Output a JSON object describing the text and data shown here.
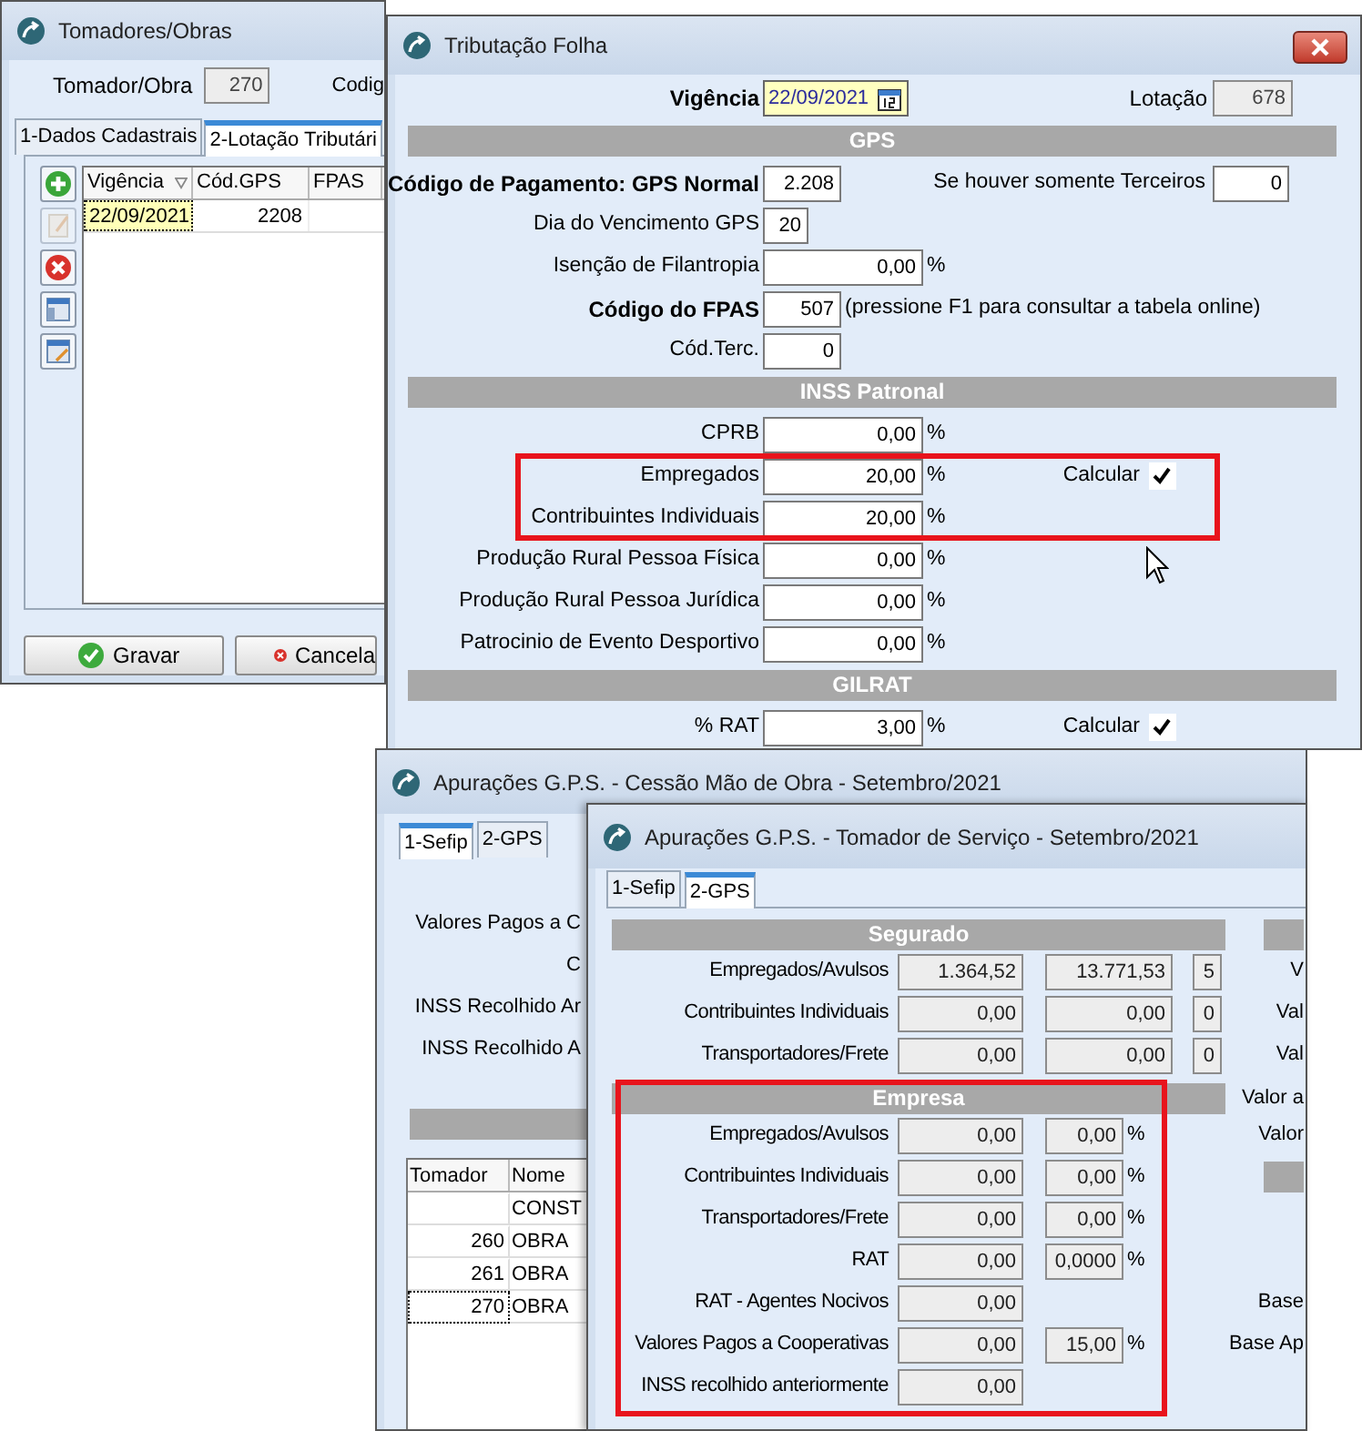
{
  "tomadores_window": {
    "title": "Tomadores/Obras",
    "tomador_label": "Tomador/Obra",
    "tomador_value": "270",
    "codigo_label": "Codig",
    "tabs": [
      {
        "label": "1-Dados Cadastrais",
        "selected": false
      },
      {
        "label": "2-Lotação Tributári",
        "selected": true
      }
    ],
    "toolbar": [
      {
        "kind": "add",
        "disabled": false
      },
      {
        "kind": "edit",
        "disabled": true
      },
      {
        "kind": "delete",
        "disabled": false
      },
      {
        "kind": "grid",
        "disabled": false
      },
      {
        "kind": "grid-edit",
        "disabled": false
      }
    ],
    "table": {
      "columns": [
        "Vigência",
        "Cód.GPS",
        "FPAS"
      ],
      "rows": [
        {
          "vigencia": "22/09/2021",
          "cod_gps": "2208",
          "selected": true
        }
      ]
    },
    "buttons": [
      {
        "kind": "save",
        "label": "Gravar"
      },
      {
        "kind": "cancel",
        "label": "Cancela"
      }
    ]
  },
  "tributacao_window": {
    "title": "Tributação Folha",
    "vigencia_label": "Vigência",
    "vigencia_value": "22/09/2021",
    "lotacao_label": "Lotação",
    "lotacao_value": "678",
    "sections": [
      {
        "title": "GPS",
        "rows": [
          {
            "label": "Código de Pagamento: GPS Normal",
            "bold": true,
            "kind": "medium",
            "value": "2.208",
            "extra": {
              "label": "Se houver somente Terceiros",
              "value": "0"
            }
          },
          {
            "label": "Dia do Vencimento GPS",
            "bold": false,
            "kind": "small",
            "value": "20"
          },
          {
            "label": "Isenção de Filantropia",
            "bold": false,
            "kind": "wide",
            "value": "0,00",
            "suffix": "%"
          },
          {
            "label": "Código do FPAS",
            "bold": true,
            "kind": "medium",
            "value": "507",
            "suffix": "(pressione F1 para consultar a tabela online)"
          },
          {
            "label": "Cód.Terc.",
            "bold": false,
            "kind": "medium",
            "value": "0"
          }
        ]
      },
      {
        "title": "INSS Patronal",
        "rows": [
          {
            "label": "CPRB",
            "bold": false,
            "kind": "wide",
            "value": "0,00",
            "suffix": "%"
          },
          {
            "label": "Empregados",
            "bold": false,
            "kind": "wide",
            "value": "20,00",
            "suffix": "%",
            "highlighted": true,
            "checkbox": {
              "label": "Calcular",
              "checked": true
            }
          },
          {
            "label": "Contribuintes Individuais",
            "bold": false,
            "kind": "wide",
            "value": "20,00",
            "suffix": "%",
            "highlighted": true
          },
          {
            "label": "Produção Rural Pessoa Física",
            "bold": false,
            "kind": "wide",
            "value": "0,00",
            "suffix": "%"
          },
          {
            "label": "Produção Rural Pessoa Jurídica",
            "bold": false,
            "kind": "wide",
            "value": "0,00",
            "suffix": "%"
          },
          {
            "label": "Patrocinio de Evento Desportivo",
            "bold": false,
            "kind": "wide",
            "value": "0,00",
            "suffix": "%"
          }
        ]
      },
      {
        "title": "GILRAT",
        "rows": [
          {
            "label": "% RAT",
            "bold": false,
            "kind": "wide",
            "value": "3,00",
            "suffix": "%",
            "checkbox": {
              "label": "Calcular",
              "checked": true
            }
          }
        ]
      }
    ]
  },
  "cessao_window": {
    "title": "Apurações G.P.S. - Cessão Mão de Obra - Setembro/2021",
    "tabs": [
      {
        "label": "1-Sefip",
        "selected": true
      },
      {
        "label": "2-GPS",
        "selected": false
      }
    ],
    "labels": [
      "Valores Pagos a C",
      "C",
      "INSS Recolhido Ar",
      "INSS Recolhido A"
    ],
    "table": {
      "columns": [
        "Tomador",
        "Nome"
      ],
      "rows": [
        {
          "nome": "CONST",
          "selected": false
        },
        {
          "tomador": "260",
          "nome": "OBRA",
          "selected": false
        },
        {
          "tomador": "261",
          "nome": "OBRA",
          "selected": false
        },
        {
          "tomador": "270",
          "nome": "OBRA",
          "selected": true
        }
      ]
    }
  },
  "tomador_window": {
    "title": "Apurações G.P.S. - Tomador de Serviço - Setembro/2021",
    "tabs": [
      {
        "label": "1-Sefip",
        "selected": false
      },
      {
        "label": "2-GPS",
        "selected": true
      }
    ],
    "segurado": {
      "title": "Segurado",
      "side": {
        "kind": "bar"
      },
      "rows": [
        {
          "label": "Empregados/Avulsos",
          "values": [
            "1.364,52",
            "13.771,53",
            "5"
          ],
          "side": {
            "kind": "label",
            "text": "V"
          }
        },
        {
          "label": "Contribuintes Individuais",
          "values": [
            "0,00",
            "0,00",
            "0"
          ],
          "side": {
            "kind": "label",
            "text": "Val"
          }
        },
        {
          "label": "Transportadores/Frete",
          "values": [
            "0,00",
            "0,00",
            "0"
          ],
          "side": {
            "kind": "label",
            "text": "Val"
          }
        }
      ]
    },
    "empresa": {
      "title": "Empresa",
      "highlighted": true,
      "side": {
        "kind": "label",
        "text": "Valor a"
      },
      "rows": [
        {
          "label": "Empregados/Avulsos",
          "value": "0,00",
          "rate": "0,00",
          "suffix": "%",
          "side": {
            "kind": "label",
            "text": "Valor"
          }
        },
        {
          "label": "Contribuintes Individuais",
          "value": "0,00",
          "rate": "0,00",
          "suffix": "%",
          "side": {
            "kind": "bar"
          }
        },
        {
          "label": "Transportadores/Frete",
          "value": "0,00",
          "rate": "0,00",
          "suffix": "%"
        },
        {
          "label": "RAT",
          "value": "0,00",
          "rate": "0,0000",
          "suffix": "%"
        },
        {
          "label": "RAT - Agentes Nocivos",
          "value": "0,00",
          "side": {
            "kind": "label",
            "text": "Base"
          }
        },
        {
          "label": "Valores Pagos a Cooperativas",
          "value": "0,00",
          "rate": "15,00",
          "suffix": "%",
          "side": {
            "kind": "label",
            "text": "Base Ap"
          }
        },
        {
          "label": "INSS recolhido anteriormente",
          "value": "0,00"
        }
      ]
    }
  }
}
